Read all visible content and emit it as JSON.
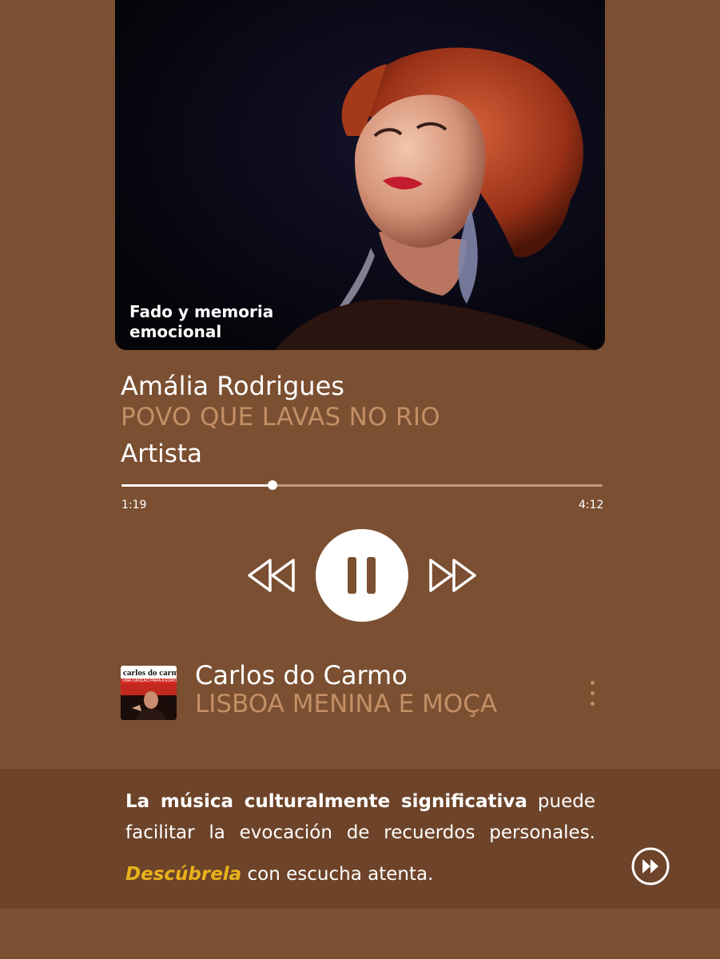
{
  "album_art": {
    "caption": "Fado y memoria emocional"
  },
  "now_playing": {
    "artist": "Amália Rodrigues",
    "title": "POVO QUE LAVAS NO RIO",
    "role": "Artista",
    "elapsed": "1:19",
    "duration": "4:12",
    "progress_fraction": 0.3135
  },
  "controls": {
    "rewind_icon": "rewind-icon",
    "pause_icon": "pause-icon",
    "fastforward_icon": "fast-forward-icon",
    "state": "playing"
  },
  "queue": {
    "item": {
      "artist": "Carlos do Carmo",
      "title": "LISBOA MENINA E MOÇA",
      "thumb_label": "carlos do carmo",
      "thumb_sublabel": "UMA CANÇÃO PARA A EUROPA",
      "menu_icon": "more-vertical-icon"
    }
  },
  "info": {
    "text_bold": "La música culturalmente significativa",
    "text_rest": " puede facilitar la evocación de recuerdos personales.",
    "discover_link": "Descúbrela",
    "discover_rest": " con escucha atenta.",
    "forward_icon": "fast-forward-circle-icon"
  },
  "colors": {
    "background": "#7b4f31",
    "panel": "#6d4329",
    "accent_text": "#c48f66",
    "link": "#e8b21c",
    "primary": "#ffffff"
  }
}
